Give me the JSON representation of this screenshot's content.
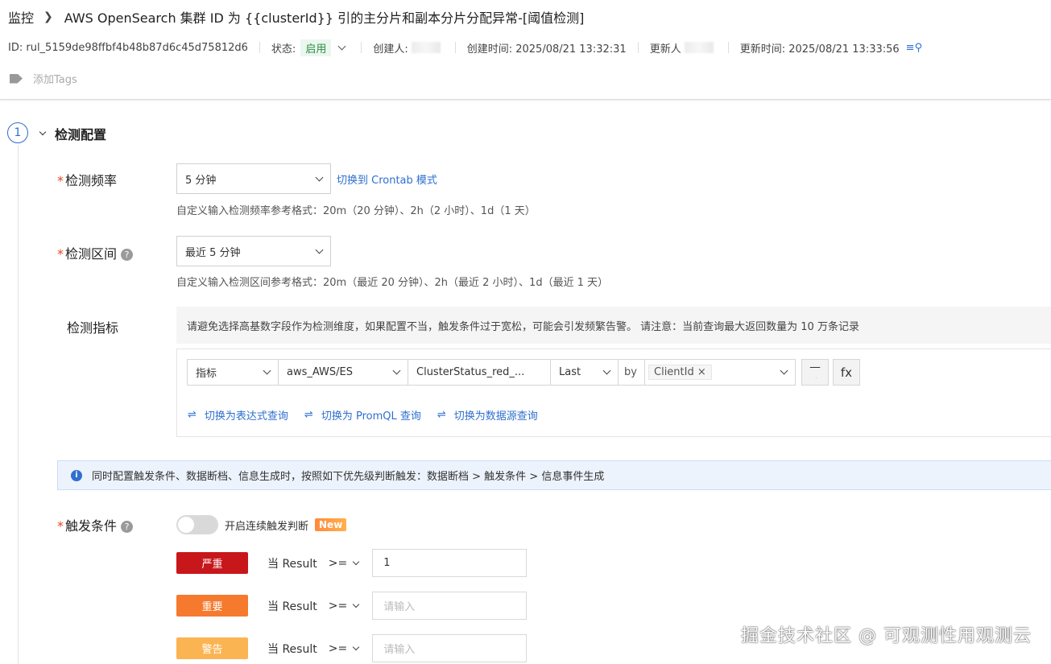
{
  "header": {
    "breadcrumb_root": "监控",
    "title": "AWS OpenSearch 集群 ID 为 {{clusterId}} 引的主分片和副本分片分配异常-[阈值检测]",
    "id_text": "ID: rul_5159de98ffbf4b48b87d6c45d75812d6",
    "status_label": "状态:",
    "status_value": "启用",
    "creator_label": "创建人:",
    "created_time": "创建时间: 2025/08/21 13:32:31",
    "updater_label": "更新人",
    "updated_time": "更新时间: 2025/08/21 13:33:56",
    "add_tags": "添加Tags"
  },
  "step": {
    "number": "1",
    "title": "检测配置"
  },
  "frequency": {
    "label": "检测频率",
    "value": "5 分钟",
    "switch_link": "切换到 Crontab 模式",
    "hint": "自定义输入检测频率参考格式：20m（20 分钟）、2h（2 小时）、1d（1 天）"
  },
  "interval": {
    "label": "检测区间",
    "value": "最近 5 分钟",
    "hint": "自定义输入检测区间参考格式：20m（最近 20 分钟）、2h（最近 2 小时）、1d（最近 1 天）"
  },
  "metric": {
    "label": "检测指标",
    "note": "请避免选择高基数字段作为检测维度，如果配置不当，触发条件过于宽松，可能会引发频繁告警。 请注意：当前查询最大返回数量为 10 万条记录",
    "type": "指标",
    "source": "aws_AWS/ES",
    "field": "ClusterStatus_red_...",
    "agg": "Last",
    "by_label": "by",
    "by_chip": "ClientId",
    "fx_label": "fx",
    "switch_links": [
      "切换为表达式查询",
      "切换为 PromQL 查询",
      "切换为数据源查询"
    ]
  },
  "alert": {
    "text": "同时配置触发条件、数据断档、信息生成时，按照如下优先级判断触发：数据断档 > 触发条件 > 信息事件生成"
  },
  "trigger": {
    "label": "触发条件",
    "toggle_label": "开启连续触发判断",
    "new_badge": "New",
    "rows": [
      {
        "severity": "严重",
        "color": "#c8171b",
        "when": "当 Result",
        "op": ">=",
        "value": "1",
        "placeholder": ""
      },
      {
        "severity": "重要",
        "color": "#f57a2e",
        "when": "当 Result",
        "op": ">=",
        "value": "",
        "placeholder": "请输入"
      },
      {
        "severity": "警告",
        "color": "#fbb452",
        "when": "当 Result",
        "op": ">=",
        "value": "",
        "placeholder": "请输入"
      }
    ]
  },
  "watermark": "掘金技术社区 @ 可观测性用观测云"
}
